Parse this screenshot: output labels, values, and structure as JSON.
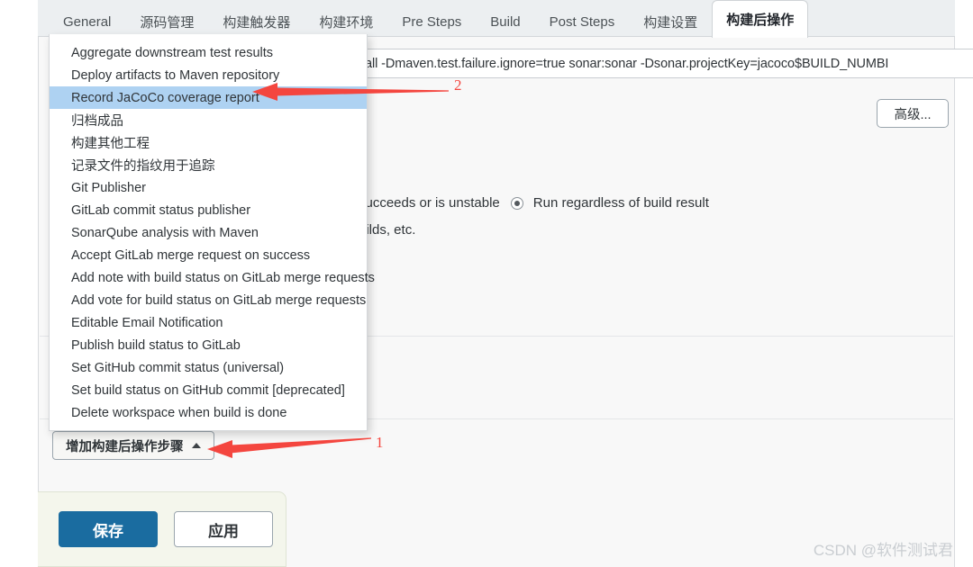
{
  "tabs": [
    {
      "label": "General",
      "active": false
    },
    {
      "label": "源码管理",
      "active": false
    },
    {
      "label": "构建触发器",
      "active": false
    },
    {
      "label": "构建环境",
      "active": false
    },
    {
      "label": "Pre Steps",
      "active": false
    },
    {
      "label": "Build",
      "active": false
    },
    {
      "label": "Post Steps",
      "active": false
    },
    {
      "label": "构建设置",
      "active": false
    },
    {
      "label": "构建后操作",
      "active": true
    }
  ],
  "form": {
    "command_field": {
      "value": "t install -Dmaven.test.failure.ignore=true sonar:sonar -Dsonar.projectKey=jacoco$BUILD_NUMBI",
      "placeholder": ""
    },
    "advanced_button": "高级...",
    "options_row": {
      "partial_text": "succeeds or is unstable",
      "selected_option": "Run regardless of build result"
    },
    "sub_note": "uilds, etc."
  },
  "menu": {
    "items": [
      "Aggregate downstream test results",
      "Deploy artifacts to Maven repository",
      "Record JaCoCo coverage report",
      "归档成品",
      "构建其他工程",
      "记录文件的指纹用于追踪",
      "Git Publisher",
      "GitLab commit status publisher",
      "SonarQube analysis with Maven",
      "Accept GitLab merge request on success",
      "Add note with build status on GitLab merge requests",
      "Add vote for build status on GitLab merge requests",
      "Editable Email Notification",
      "Publish build status to GitLab",
      "Set GitHub commit status (universal)",
      "Set build status on GitHub commit [deprecated]",
      "Delete workspace when build is done"
    ],
    "selected_index": 2
  },
  "add_step_button": {
    "label": "增加构建后操作步骤",
    "caret": "caret-up-icon"
  },
  "footer": {
    "save_label": "保存",
    "apply_label": "应用"
  },
  "annotations": [
    {
      "number": "1",
      "target": "add-step-button"
    },
    {
      "number": "2",
      "target": "menu-item-record-jacoco"
    }
  ],
  "watermark": "CSDN @软件测试君",
  "colors": {
    "accent_blue": "#1a6ca0",
    "menu_highlight": "#aed2f2",
    "annotation_red": "#f4463f",
    "tabbar_bg": "#eceff1",
    "content_bg": "#f8f8f8",
    "save_bar_bg": "#f4f6ec"
  }
}
